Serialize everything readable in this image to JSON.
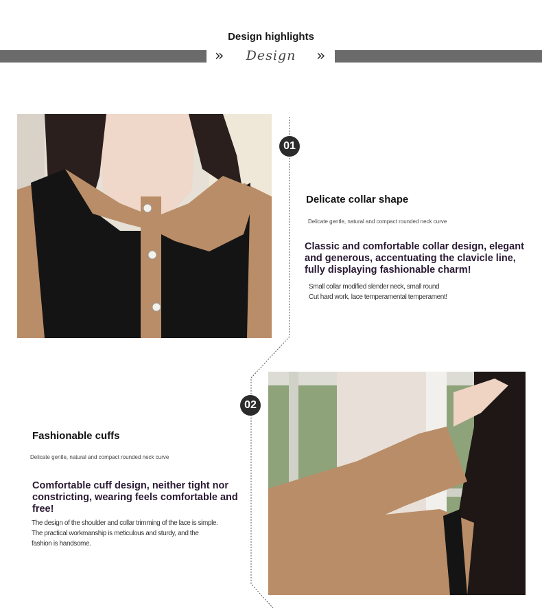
{
  "header": {
    "title": "Design highlights",
    "script_word": "Design",
    "chevron_glyph": "»"
  },
  "sections": [
    {
      "number": "01",
      "title": "Delicate collar shape",
      "caption": "Delicate gentle, natural and compact rounded neck curve",
      "headline": "Classic and comfortable collar design, elegant and generous, accentuating the clavicle line, fully displaying fashionable charm!",
      "desc_lines": [
        "Small collar modified slender neck, small round",
        "Cut hard work, lace temperamental temperament!"
      ],
      "photo_icon": "collar-closeup-photo"
    },
    {
      "number": "02",
      "title": "Fashionable cuffs",
      "caption": "Delicate gentle, natural and compact rounded neck curve",
      "headline": "Comfortable cuff design, neither tight nor constricting, wearing feels comfortable and free!",
      "desc_lines": [
        "The design of the shoulder and collar trimming of the lace is simple.",
        "The practical workmanship is meticulous and sturdy, and the",
        " fashion is handsome."
      ],
      "photo_icon": "sleeve-cuff-photo"
    }
  ],
  "colors": {
    "bar": "#6b6b6b",
    "badge": "#2b2b2b",
    "camel": "#b98d68",
    "black": "#141414"
  }
}
